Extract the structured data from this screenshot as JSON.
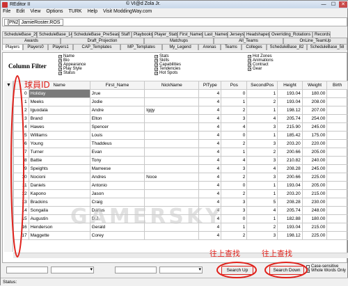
{
  "titlebar": {
    "title": "REditor II",
    "copyright": "© VI@d Zola Jr.",
    "min": "—",
    "max": "☐",
    "close": "✕"
  },
  "menu": [
    "File",
    "Edit",
    "View",
    "Options",
    "TURK",
    "Help",
    "Visit ModdingWay.com"
  ],
  "file_tab": "[PN2] JamieRoster.ROS",
  "tabs_row1": [
    "ScheduleBase_29",
    "ScheduleBase_14",
    "ScheduleBase_PreSeason",
    "Staff",
    "Playbooks",
    "Player_Stats",
    "First_Names",
    "Last_Names",
    "Jerseys",
    "Headshapes",
    "Overriding_Rotations",
    "Records"
  ],
  "tabs_row2": [
    "Awards",
    "Draft_Projection",
    "Matchups",
    "All_Teams",
    "OnLine_TeamUp"
  ],
  "tabs_row3": [
    "Players",
    "Players0",
    "Players1",
    "CAP_Templates",
    "MP_Templates",
    "My_Legend",
    "Arenas",
    "Teams",
    "Colleges",
    "ScheduleBase_82",
    "ScheduleBase_58"
  ],
  "active_tab": "Players",
  "column_filter": {
    "title": "Column Filter",
    "col1": [
      "Name",
      "Bio",
      "Appearance",
      "Play Style",
      "Status"
    ],
    "col2": [
      "Stats",
      "Skills",
      "Capabilities",
      "Tendencies",
      "Hot Spots"
    ],
    "col3": [
      "Hot Zones",
      "Animations",
      "Contract",
      "Gear"
    ]
  },
  "table": {
    "columns": [
      "Name",
      "First_Name",
      "NickName",
      "PlType",
      "Pos",
      "SecondPos",
      "Height",
      "Weight",
      "Birth"
    ],
    "rows": [
      [
        "Holiday",
        "Jrue",
        "",
        "4",
        "0",
        "1",
        "193.04",
        "180.00"
      ],
      [
        "Meeks",
        "Jodie",
        "",
        "4",
        "1",
        "2",
        "193.04",
        "208.00"
      ],
      [
        "Iguodala",
        "Andre",
        "Iggy",
        "4",
        "2",
        "1",
        "198.12",
        "207.00"
      ],
      [
        "Brand",
        "Elton",
        "",
        "4",
        "3",
        "4",
        "205.74",
        "254.00"
      ],
      [
        "Hawes",
        "Spencer",
        "",
        "4",
        "4",
        "3",
        "215.90",
        "245.00"
      ],
      [
        "Williams",
        "Louis",
        "",
        "4",
        "0",
        "1",
        "185.42",
        "175.00"
      ],
      [
        "Young",
        "Thaddeus",
        "",
        "4",
        "2",
        "3",
        "203.20",
        "220.00"
      ],
      [
        "Turner",
        "Evan",
        "",
        "4",
        "1",
        "2",
        "200.66",
        "205.00"
      ],
      [
        "Battie",
        "Tony",
        "",
        "4",
        "4",
        "3",
        "210.82",
        "240.00"
      ],
      [
        "Speights",
        "Marreese",
        "",
        "4",
        "3",
        "4",
        "208.28",
        "245.00"
      ],
      [
        "Nocioni",
        "Andres",
        "Noce",
        "4",
        "2",
        "3",
        "200.66",
        "225.00"
      ],
      [
        "Daniels",
        "Antonio",
        "",
        "4",
        "0",
        "1",
        "193.04",
        "205.00"
      ],
      [
        "Kapono",
        "Jason",
        "",
        "4",
        "2",
        "1",
        "203.20",
        "215.00"
      ],
      [
        "Brackins",
        "Craig",
        "",
        "4",
        "3",
        "5",
        "208.28",
        "230.00"
      ],
      [
        "Songaila",
        "Darius",
        "",
        "4",
        "3",
        "4",
        "205.74",
        "248.00"
      ],
      [
        "Augustin",
        "D.J.",
        "",
        "4",
        "0",
        "1",
        "182.88",
        "180.00"
      ],
      [
        "Henderson",
        "Gerald",
        "",
        "4",
        "1",
        "2",
        "193.04",
        "215.00"
      ],
      [
        "Maggette",
        "Corey",
        "",
        "4",
        "2",
        "3",
        "198.12",
        "225.00"
      ]
    ]
  },
  "annotations": {
    "left_label": "球員ID",
    "search_up_label": "往上查找",
    "search_down_label": "往上查找"
  },
  "bottom": {
    "search_up": "Search Up",
    "search_down": "Search Down",
    "case_sensitive": "Case-sensitive",
    "whole_words": "Whole Words Only"
  },
  "status": "Status:",
  "watermark": "GAMERSKY",
  "colors": {
    "annotation": "#e0211b",
    "selected_cell": "#7a7a7a"
  }
}
